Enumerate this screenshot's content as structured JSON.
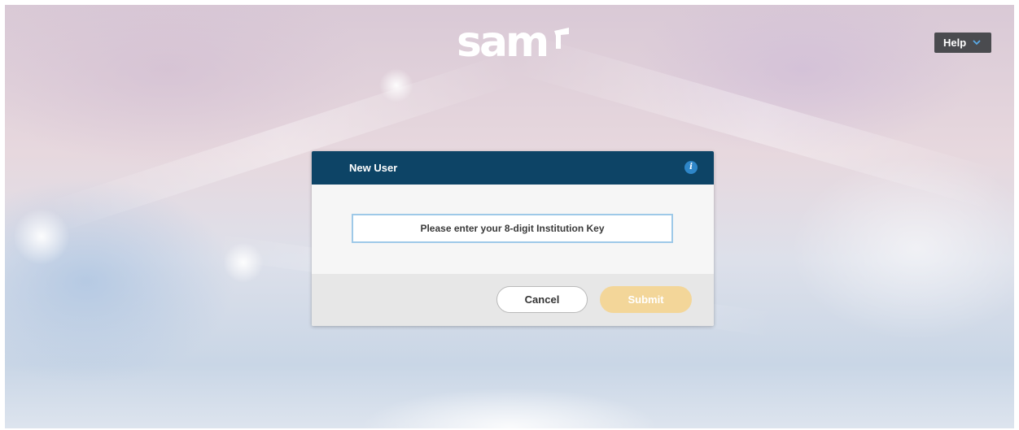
{
  "brand": {
    "logo_text": "sam"
  },
  "help": {
    "label": "Help",
    "icon": "chevron-down-icon"
  },
  "dialog": {
    "title": "New User",
    "info_icon": "info-icon",
    "institution_key": {
      "value": "",
      "placeholder": "Please enter your 8-digit Institution Key"
    },
    "cancel_label": "Cancel",
    "submit_label": "Submit",
    "submit_enabled": false
  },
  "colors": {
    "header_bg": "#0d4466",
    "info_icon": "#2e86c8",
    "submit_disabled": "#f3d699",
    "help_bg": "#4a4b4f",
    "input_border": "#9ec9e8"
  }
}
